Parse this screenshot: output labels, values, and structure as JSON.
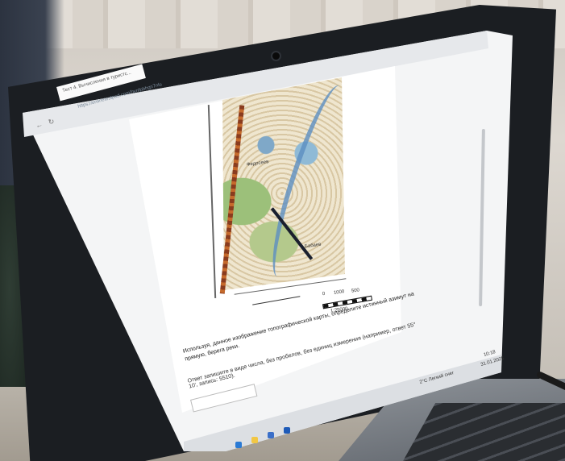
{
  "browser": {
    "tab_title": "Тест 4. Вычисления в туристс...",
    "url": "https://onlinetestpad.com/hvnfpbhgn7nlu",
    "back_icon": "back-arrow-icon",
    "forward_icon": "forward-arrow-icon",
    "reload_icon": "reload-icon"
  },
  "map": {
    "labels": [
      "Федосеев",
      "Бабаев",
      "0",
      "1000",
      "500",
      "2000"
    ],
    "scale_caption": "1:25000"
  },
  "question": {
    "text": "Используя, данное изображение топографической карты, определите истинный азимут на прямую, берега реки.",
    "hint": "Ответ запишите в виде числа, без пробелов, без единиц измерения (например, ответ 55° 10', запись: 5510)."
  },
  "taskbar": {
    "weather": "2°C Легкий снег",
    "time": "10:18",
    "date": "31.01.2025"
  }
}
